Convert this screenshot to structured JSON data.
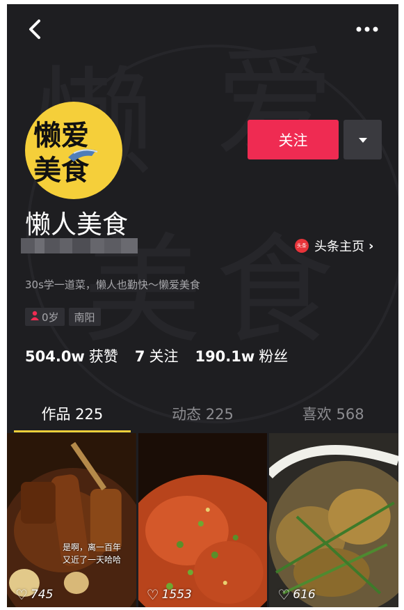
{
  "header": {
    "back_icon": "chevron-left-icon",
    "more_icon": "ellipsis-icon"
  },
  "watermark": {
    "chars": [
      "懒",
      "爱",
      "美",
      "食"
    ]
  },
  "profile": {
    "avatar_text_line1": "懒爱",
    "avatar_text_line2": "美食",
    "name": "懒人美食",
    "follow_label": "关注",
    "toutiao_label": "头条主页",
    "toutiao_logo_text": "头条",
    "bio": "30s学一道菜，懒人也勤快～懒爱美食",
    "tags": [
      {
        "label": "0岁",
        "icon": "person-icon"
      },
      {
        "label": "南阳"
      }
    ],
    "stats": [
      {
        "value": "504.0w",
        "label": "获赞"
      },
      {
        "value": "7",
        "label": "关注"
      },
      {
        "value": "190.1w",
        "label": "粉丝"
      }
    ]
  },
  "tabs": [
    {
      "label": "作品 225",
      "active": true
    },
    {
      "label": "动态 225",
      "active": false
    },
    {
      "label": "喜欢 568",
      "active": false
    }
  ],
  "videos": [
    {
      "likes": "745",
      "caption_line1": "是啊，离一百年",
      "caption_line2": "又近了一天哈哈"
    },
    {
      "likes": "1553"
    },
    {
      "likes": "616"
    }
  ],
  "colors": {
    "accent": "#ef2b52",
    "tab_indicator": "#f5cf3a",
    "background": "#1e1e21"
  }
}
